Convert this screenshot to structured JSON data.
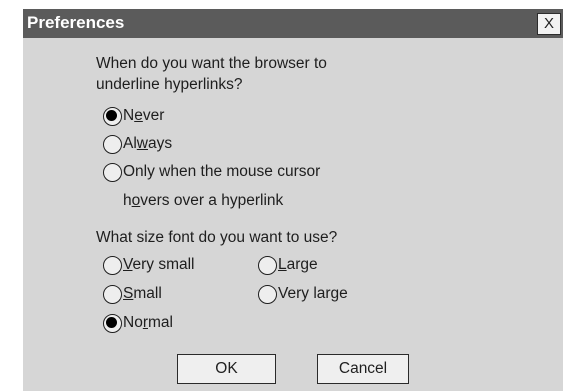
{
  "window": {
    "title": "Preferences",
    "close_label": "X"
  },
  "underline_section": {
    "question_line1": "When do you want the browser to",
    "question_line2": "underline hyperlinks?",
    "options": [
      {
        "prefix": "N",
        "underlined": "e",
        "suffix": "ver",
        "selected": true
      },
      {
        "prefix": "Al",
        "underlined": "w",
        "suffix": "ays",
        "selected": false
      },
      {
        "line1": "Only when the mouse cursor",
        "line2_prefix": "h",
        "line2_underlined": "o",
        "line2_suffix": "vers over a hyperlink",
        "selected": false
      }
    ]
  },
  "font_section": {
    "question": "What size font do you want to use?",
    "options": [
      {
        "prefix": "",
        "underlined": "V",
        "suffix": "ery small",
        "selected": false
      },
      {
        "prefix": "",
        "underlined": "L",
        "suffix": "arge",
        "selected": false
      },
      {
        "prefix": "",
        "underlined": "S",
        "suffix": "mall",
        "selected": false
      },
      {
        "prefix": "Very large",
        "underlined": "",
        "suffix": "",
        "selected": false
      },
      {
        "prefix": "No",
        "underlined": "r",
        "suffix": "mal",
        "selected": true
      }
    ]
  },
  "buttons": {
    "ok": "OK",
    "cancel": "Cancel"
  }
}
